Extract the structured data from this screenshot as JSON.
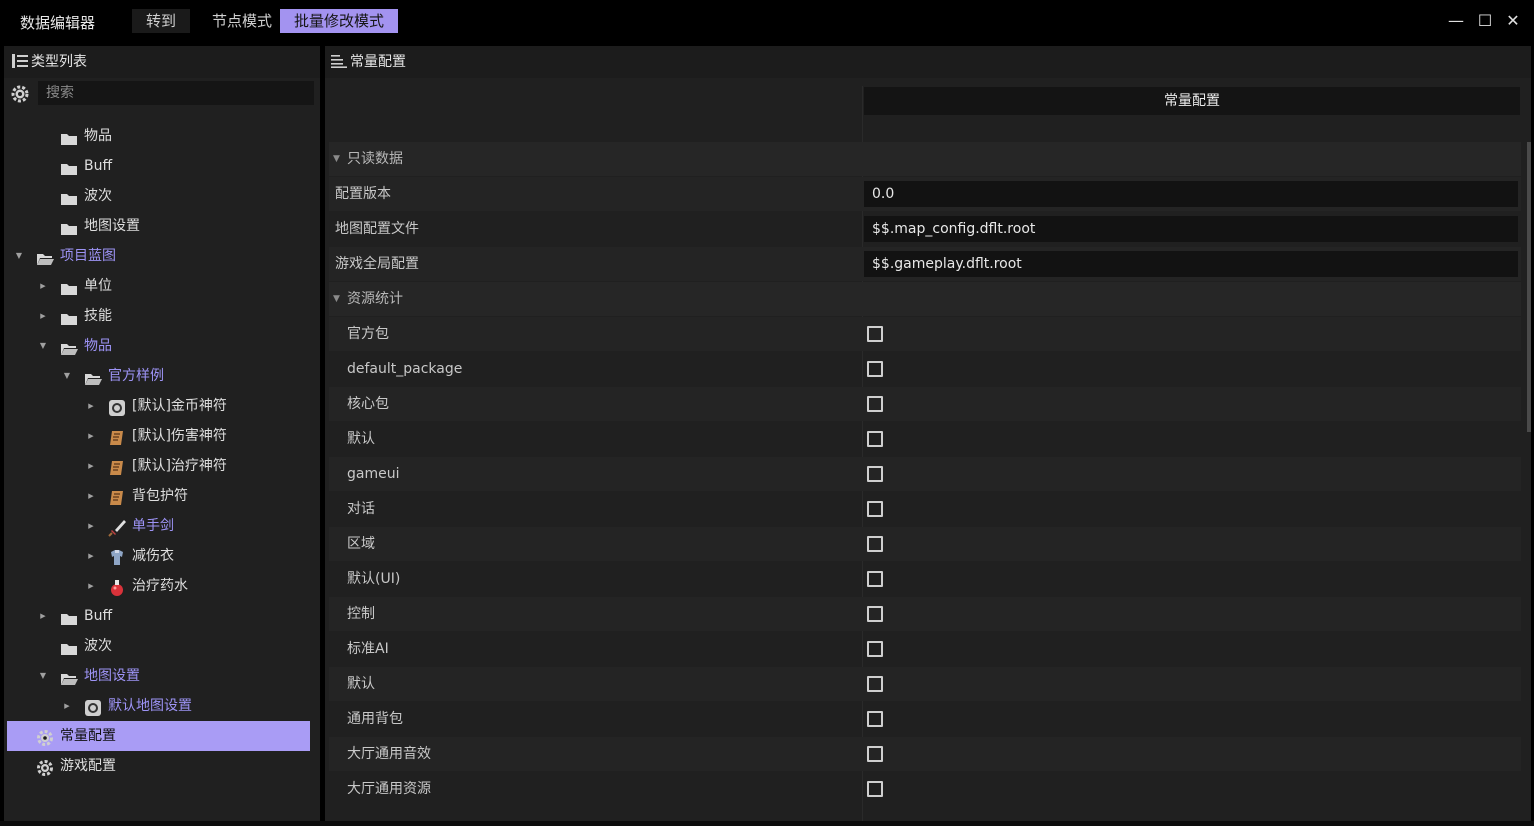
{
  "app_title": "数据编辑器",
  "menu": {
    "goto": "转到",
    "node_mode": "节点模式",
    "batch_mode": "批量修改模式"
  },
  "window": {
    "minimize": "—",
    "maximize": "☐",
    "close": "✕"
  },
  "left_panel": {
    "header": "类型列表",
    "search_placeholder": "搜索",
    "tree": [
      {
        "label": "物品",
        "icon": "folder-icon",
        "level": 2,
        "arrow": ""
      },
      {
        "label": "Buff",
        "icon": "folder-icon",
        "level": 2,
        "arrow": ""
      },
      {
        "label": "波次",
        "icon": "folder-icon",
        "level": 2,
        "arrow": ""
      },
      {
        "label": "地图设置",
        "icon": "folder-icon",
        "level": 2,
        "arrow": ""
      },
      {
        "label": "项目蓝图",
        "icon": "folder-open-icon",
        "level": 1,
        "arrow": "down",
        "blue": true
      },
      {
        "label": "单位",
        "icon": "folder-icon",
        "level": 2,
        "arrow": "right"
      },
      {
        "label": "技能",
        "icon": "folder-icon",
        "level": 2,
        "arrow": "right"
      },
      {
        "label": "物品",
        "icon": "folder-open-icon",
        "level": 2,
        "arrow": "down",
        "blue": true
      },
      {
        "label": "官方样例",
        "icon": "folder-open-icon",
        "level": 3,
        "arrow": "down",
        "blue": true
      },
      {
        "label": "[默认]金币神符",
        "icon": "coin-icon",
        "level": 4,
        "arrow": "right"
      },
      {
        "label": "[默认]伤害神符",
        "icon": "scroll-icon",
        "level": 4,
        "arrow": "right"
      },
      {
        "label": "[默认]治疗神符",
        "icon": "scroll-icon",
        "level": 4,
        "arrow": "right"
      },
      {
        "label": "背包护符",
        "icon": "scroll-icon",
        "level": 4,
        "arrow": "right"
      },
      {
        "label": "单手剑",
        "icon": "sword-icon",
        "level": 4,
        "arrow": "right",
        "blue": true
      },
      {
        "label": "减伤衣",
        "icon": "armor-icon",
        "level": 4,
        "arrow": "right"
      },
      {
        "label": "治疗药水",
        "icon": "potion-icon",
        "level": 4,
        "arrow": "right"
      },
      {
        "label": "Buff",
        "icon": "folder-icon",
        "level": 2,
        "arrow": "right"
      },
      {
        "label": "波次",
        "icon": "folder-icon",
        "level": 2,
        "arrow": ""
      },
      {
        "label": "地图设置",
        "icon": "folder-open-icon",
        "level": 2,
        "arrow": "down",
        "blue": true
      },
      {
        "label": "默认地图设置",
        "icon": "map-icon",
        "level": 3,
        "arrow": "right",
        "blue": true
      },
      {
        "label": "常量配置",
        "icon": "gear-icon",
        "level": 1,
        "arrow": "",
        "selected": true
      },
      {
        "label": "游戏配置",
        "icon": "gear-icon",
        "level": 1,
        "arrow": ""
      }
    ]
  },
  "right_panel": {
    "header": "常量配置",
    "column_header": "常量配置",
    "sections": {
      "readonly": "只读数据",
      "resources": "资源统计"
    },
    "fields": [
      {
        "label": "配置版本",
        "value": "0.0"
      },
      {
        "label": "地图配置文件",
        "value": "$$.map_config.dflt.root"
      },
      {
        "label": "游戏全局配置",
        "value": "$$.gameplay.dflt.root"
      }
    ],
    "resources": [
      {
        "label": "官方包",
        "checked": false
      },
      {
        "label": "default_package",
        "checked": false
      },
      {
        "label": "核心包",
        "checked": false
      },
      {
        "label": "默认",
        "checked": false
      },
      {
        "label": "gameui",
        "checked": false
      },
      {
        "label": "对话",
        "checked": false
      },
      {
        "label": "区域",
        "checked": false
      },
      {
        "label": "默认(UI)",
        "checked": false
      },
      {
        "label": "控制",
        "checked": false
      },
      {
        "label": "标准AI",
        "checked": false
      },
      {
        "label": "默认",
        "checked": false
      },
      {
        "label": "通用背包",
        "checked": false
      },
      {
        "label": "大厅通用音效",
        "checked": false
      },
      {
        "label": "大厅通用资源",
        "checked": false
      }
    ]
  },
  "colors": {
    "accent": "#a393f0",
    "link_blue": "#9d93f5",
    "panel_bg": "#202020"
  }
}
